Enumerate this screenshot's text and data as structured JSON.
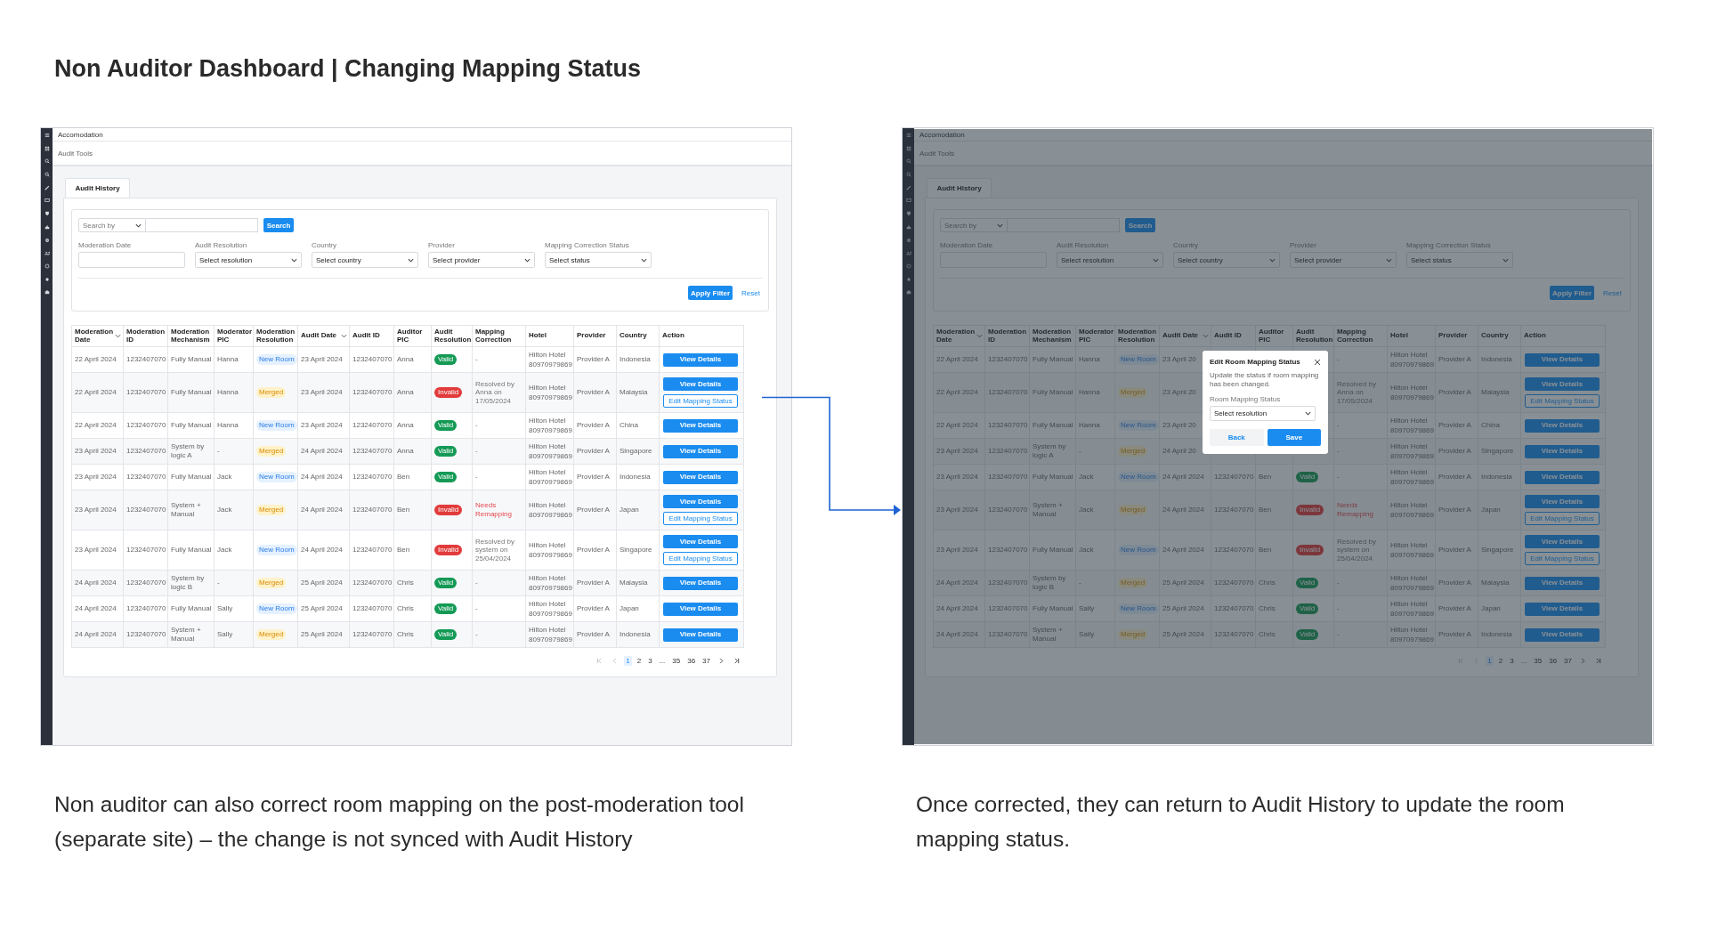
{
  "title": "Non Auditor Dashboard | Changing Mapping Status",
  "screens": [
    {
      "breadcrumb": "Accomodation",
      "section": "Audit Tools",
      "tabs": [
        {
          "label": "Audit History",
          "selected": true
        }
      ],
      "search": {
        "by": "Search by",
        "button": "Search"
      },
      "filters": [
        {
          "label": "Moderation Date",
          "kind": "date"
        },
        {
          "label": "Audit Resolution",
          "kind": "select",
          "value": "Select resolution"
        },
        {
          "label": "Country",
          "kind": "select",
          "value": "Select country"
        },
        {
          "label": "Provider",
          "kind": "select",
          "value": "Select provider"
        },
        {
          "label": "Mapping Correction Status",
          "kind": "select",
          "value": "Select status"
        }
      ],
      "apply_button": "Apply Filter",
      "reset_link": "Reset",
      "columns": [
        {
          "label": "Moderation Date",
          "sortable": true
        },
        {
          "label": "Moderation ID",
          "sortable": false
        },
        {
          "label": "Moderation Mechanism",
          "sortable": false
        },
        {
          "label": "Moderator PIC",
          "sortable": false
        },
        {
          "label": "Moderation Resolution",
          "sortable": false
        },
        {
          "label": "Audit Date",
          "sortable": true
        },
        {
          "label": "Audit ID",
          "sortable": false
        },
        {
          "label": "Auditor PIC",
          "sortable": false
        },
        {
          "label": "Audit Resolution",
          "sortable": false
        },
        {
          "label": "Mapping Correction",
          "sortable": false
        },
        {
          "label": "Hotel",
          "sortable": false
        },
        {
          "label": "Provider",
          "sortable": false
        },
        {
          "label": "Country",
          "sortable": false
        },
        {
          "label": "Action",
          "sortable": false
        }
      ],
      "rows": [
        {
          "moderation_date": "22 April 2024",
          "moderation_id": "1232407070",
          "mechanism": "Fully Manual",
          "moderator": "Hanna",
          "moderation_resolution": {
            "text": "New Room",
            "kind": "new_room"
          },
          "audit_date": "23 April 2024",
          "audit_id": "1232407070",
          "auditor": "Anna",
          "audit_resolution": {
            "text": "Valid",
            "kind": "valid"
          },
          "mapping_correction": {
            "text": "-",
            "kind": "plain"
          },
          "hotel": "Hilton Hotel",
          "hotel_code": "80970979869",
          "provider": "Provider A",
          "country": "Indonesia",
          "actions": [
            {
              "label": "View Details",
              "kind": "primary"
            }
          ]
        },
        {
          "moderation_date": "22 April 2024",
          "moderation_id": "1232407070",
          "mechanism": "Fully Manual",
          "moderator": "Hanna",
          "moderation_resolution": {
            "text": "Merged",
            "kind": "merged"
          },
          "audit_date": "23 April 2024",
          "audit_id": "1232407070",
          "auditor": "Anna",
          "audit_resolution": {
            "text": "Invalid",
            "kind": "invalid"
          },
          "mapping_correction": {
            "text": "Resolved by Anna on 17/05/2024",
            "kind": "plain"
          },
          "hotel": "Hilton Hotel",
          "hotel_code": "80970979869",
          "provider": "Provider A",
          "country": "Malaysia",
          "actions": [
            {
              "label": "View Details",
              "kind": "primary"
            },
            {
              "label": "Edit Mapping Status",
              "kind": "outline"
            }
          ]
        },
        {
          "moderation_date": "22 April 2024",
          "moderation_id": "1232407070",
          "mechanism": "Fully Manual",
          "moderator": "Hanna",
          "moderation_resolution": {
            "text": "New Room",
            "kind": "new_room"
          },
          "audit_date": "23 April 2024",
          "audit_id": "1232407070",
          "auditor": "Anna",
          "audit_resolution": {
            "text": "Valid",
            "kind": "valid"
          },
          "mapping_correction": {
            "text": "-",
            "kind": "plain"
          },
          "hotel": "Hilton Hotel",
          "hotel_code": "80970979869",
          "provider": "Provider A",
          "country": "China",
          "actions": [
            {
              "label": "View Details",
              "kind": "primary"
            }
          ]
        },
        {
          "moderation_date": "23 April 2024",
          "moderation_id": "1232407070",
          "mechanism": "System by logic A",
          "moderator": "-",
          "moderation_resolution": {
            "text": "Merged",
            "kind": "merged"
          },
          "audit_date": "24 April 2024",
          "audit_id": "1232407070",
          "auditor": "Anna",
          "audit_resolution": {
            "text": "Valid",
            "kind": "valid"
          },
          "mapping_correction": {
            "text": "-",
            "kind": "plain"
          },
          "hotel": "Hilton Hotel",
          "hotel_code": "80970979869",
          "provider": "Provider A",
          "country": "Singapore",
          "actions": [
            {
              "label": "View Details",
              "kind": "primary"
            }
          ]
        },
        {
          "moderation_date": "23 April 2024",
          "moderation_id": "1232407070",
          "mechanism": "Fully Manual",
          "moderator": "Jack",
          "moderation_resolution": {
            "text": "New Room",
            "kind": "new_room"
          },
          "audit_date": "24 April 2024",
          "audit_id": "1232407070",
          "auditor": "Ben",
          "audit_resolution": {
            "text": "Valid",
            "kind": "valid"
          },
          "mapping_correction": {
            "text": "-",
            "kind": "plain"
          },
          "hotel": "Hilton Hotel",
          "hotel_code": "80970979869",
          "provider": "Provider A",
          "country": "Indonesia",
          "actions": [
            {
              "label": "View Details",
              "kind": "primary"
            }
          ]
        },
        {
          "moderation_date": "23 April 2024",
          "moderation_id": "1232407070",
          "mechanism": "System + Manual",
          "moderator": "Jack",
          "moderation_resolution": {
            "text": "Merged",
            "kind": "merged"
          },
          "audit_date": "24 April 2024",
          "audit_id": "1232407070",
          "auditor": "Ben",
          "audit_resolution": {
            "text": "Invalid",
            "kind": "invalid"
          },
          "mapping_correction": {
            "text": "Needs Remapping",
            "kind": "alert"
          },
          "hotel": "Hilton Hotel",
          "hotel_code": "80970979869",
          "provider": "Provider A",
          "country": "Japan",
          "actions": [
            {
              "label": "View Details",
              "kind": "primary"
            },
            {
              "label": "Edit Mapping Status",
              "kind": "outline"
            }
          ]
        },
        {
          "moderation_date": "23 April 2024",
          "moderation_id": "1232407070",
          "mechanism": "Fully Manual",
          "moderator": "Jack",
          "moderation_resolution": {
            "text": "New Room",
            "kind": "new_room"
          },
          "audit_date": "24 April 2024",
          "audit_id": "1232407070",
          "auditor": "Ben",
          "audit_resolution": {
            "text": "Invalid",
            "kind": "invalid"
          },
          "mapping_correction": {
            "text": "Resolved by system on 25/04/2024",
            "kind": "plain"
          },
          "hotel": "Hilton Hotel",
          "hotel_code": "80970979869",
          "provider": "Provider A",
          "country": "Singapore",
          "actions": [
            {
              "label": "View Details",
              "kind": "primary"
            },
            {
              "label": "Edit Mapping Status",
              "kind": "outline"
            }
          ]
        },
        {
          "moderation_date": "24 April 2024",
          "moderation_id": "1232407070",
          "mechanism": "System by logic B",
          "moderator": "-",
          "moderation_resolution": {
            "text": "Merged",
            "kind": "merged"
          },
          "audit_date": "25 April 2024",
          "audit_id": "1232407070",
          "auditor": "Chris",
          "audit_resolution": {
            "text": "Valid",
            "kind": "valid"
          },
          "mapping_correction": {
            "text": "-",
            "kind": "plain"
          },
          "hotel": "Hilton Hotel",
          "hotel_code": "80970979869",
          "provider": "Provider A",
          "country": "Malaysia",
          "actions": [
            {
              "label": "View Details",
              "kind": "primary"
            }
          ]
        },
        {
          "moderation_date": "24 April 2024",
          "moderation_id": "1232407070",
          "mechanism": "Fully Manual",
          "moderator": "Sally",
          "moderation_resolution": {
            "text": "New Room",
            "kind": "new_room"
          },
          "audit_date": "25 April 2024",
          "audit_id": "1232407070",
          "auditor": "Chris",
          "audit_resolution": {
            "text": "Valid",
            "kind": "valid"
          },
          "mapping_correction": {
            "text": "-",
            "kind": "plain"
          },
          "hotel": "Hilton Hotel",
          "hotel_code": "80970979869",
          "provider": "Provider A",
          "country": "Japan",
          "actions": [
            {
              "label": "View Details",
              "kind": "primary"
            }
          ]
        },
        {
          "moderation_date": "24 April 2024",
          "moderation_id": "1232407070",
          "mechanism": "System + Manual",
          "moderator": "Sally",
          "moderation_resolution": {
            "text": "Merged",
            "kind": "merged"
          },
          "audit_date": "25 April 2024",
          "audit_id": "1232407070",
          "auditor": "Chris",
          "audit_resolution": {
            "text": "Valid",
            "kind": "valid"
          },
          "mapping_correction": {
            "text": "-",
            "kind": "plain"
          },
          "hotel": "Hilton Hotel",
          "hotel_code": "80970979869",
          "provider": "Provider A",
          "country": "Indonesia",
          "actions": [
            {
              "label": "View Details",
              "kind": "primary"
            }
          ]
        }
      ],
      "pagination": [
        {
          "label": "1",
          "selected": true
        },
        {
          "label": "2",
          "selected": false
        },
        {
          "label": "3",
          "selected": false
        },
        {
          "label": "...",
          "selected": false
        },
        {
          "label": "35",
          "selected": false
        },
        {
          "label": "36",
          "selected": false
        },
        {
          "label": "37",
          "selected": false
        }
      ],
      "caption": "Non auditor can also correct room mapping on the post-moderation tool (separate site) – the change is not synced with Audit History"
    },
    {
      "breadcrumb": "Accomodation",
      "section": "Audit Tools",
      "tabs": [
        {
          "label": "Audit History",
          "selected": true
        }
      ],
      "search": {
        "by": "Search by",
        "button": "Search"
      },
      "filters": [
        {
          "label": "Moderation Date",
          "kind": "date"
        },
        {
          "label": "Audit Resolution",
          "kind": "select",
          "value": "Select resolution"
        },
        {
          "label": "Country",
          "kind": "select",
          "value": "Select country"
        },
        {
          "label": "Provider",
          "kind": "select",
          "value": "Select provider"
        },
        {
          "label": "Mapping Correction Status",
          "kind": "select",
          "value": "Select status"
        }
      ],
      "apply_button": "Apply Filter",
      "reset_link": "Reset",
      "columns": [
        {
          "label": "Moderation Date",
          "sortable": true
        },
        {
          "label": "Moderation ID",
          "sortable": false
        },
        {
          "label": "Moderation Mechanism",
          "sortable": false
        },
        {
          "label": "Moderator PIC",
          "sortable": false
        },
        {
          "label": "Moderation Resolution",
          "sortable": false
        },
        {
          "label": "Audit Date",
          "sortable": true
        },
        {
          "label": "Audit ID",
          "sortable": false
        },
        {
          "label": "Auditor PIC",
          "sortable": false
        },
        {
          "label": "Audit Resolution",
          "sortable": false
        },
        {
          "label": "Mapping Correction",
          "sortable": false
        },
        {
          "label": "Hotel",
          "sortable": false
        },
        {
          "label": "Provider",
          "sortable": false
        },
        {
          "label": "Country",
          "sortable": false
        },
        {
          "label": "Action",
          "sortable": false
        }
      ],
      "rows": [
        {
          "moderation_date": "22 April 2024",
          "moderation_id": "1232407070",
          "mechanism": "Fully Manual",
          "moderator": "Hanna",
          "moderation_resolution": {
            "text": "New Room",
            "kind": "new_room"
          },
          "audit_date": "23 April 20",
          "mapping_correction": {
            "text": "-",
            "kind": "plain"
          },
          "hotel": "Hilton Hotel",
          "hotel_code": "80970979869",
          "provider": "Provider A",
          "country": "Indonesia",
          "actions": [
            {
              "label": "View Details",
              "kind": "primary"
            }
          ]
        },
        {
          "moderation_date": "22 April 2024",
          "moderation_id": "1232407070",
          "mechanism": "Fully Manual",
          "moderator": "Hanna",
          "moderation_resolution": {
            "text": "Merged",
            "kind": "merged"
          },
          "audit_date": "23 April 20",
          "mapping_correction": {
            "text": "Resolved by Anna on 17/05/2024",
            "kind": "plain"
          },
          "hotel": "Hilton Hotel",
          "hotel_code": "80970979869",
          "provider": "Provider A",
          "country": "Malaysia",
          "actions": [
            {
              "label": "View Details",
              "kind": "primary"
            },
            {
              "label": "Edit Mapping Status",
              "kind": "outline"
            }
          ]
        },
        {
          "moderation_date": "22 April 2024",
          "moderation_id": "1232407070",
          "mechanism": "Fully Manual",
          "moderator": "Hanna",
          "moderation_resolution": {
            "text": "New Room",
            "kind": "new_room"
          },
          "audit_date": "23 April 20",
          "mapping_correction": {
            "text": "-",
            "kind": "plain"
          },
          "hotel": "Hilton Hotel",
          "hotel_code": "80970979869",
          "provider": "Provider A",
          "country": "China",
          "actions": [
            {
              "label": "View Details",
              "kind": "primary"
            }
          ]
        },
        {
          "moderation_date": "23 April 2024",
          "moderation_id": "1232407070",
          "mechanism": "System by logic A",
          "moderator": "-",
          "moderation_resolution": {
            "text": "Merged",
            "kind": "merged"
          },
          "audit_date": "24 April 20",
          "mapping_correction": {
            "text": "-",
            "kind": "plain"
          },
          "hotel": "Hilton Hotel",
          "hotel_code": "80970979869",
          "provider": "Provider A",
          "country": "Singapore",
          "actions": [
            {
              "label": "View Details",
              "kind": "primary"
            }
          ]
        },
        {
          "moderation_date": "23 April 2024",
          "moderation_id": "1232407070",
          "mechanism": "Fully Manual",
          "moderator": "Jack",
          "moderation_resolution": {
            "text": "New Room",
            "kind": "new_room"
          },
          "audit_date": "24 April 2024",
          "audit_id": "1232407070",
          "auditor": "Ben",
          "audit_resolution": {
            "text": "Valid",
            "kind": "valid"
          },
          "mapping_correction": {
            "text": "-",
            "kind": "plain"
          },
          "hotel": "Hilton Hotel",
          "hotel_code": "80970979869",
          "provider": "Provider A",
          "country": "Indonesia",
          "actions": [
            {
              "label": "View Details",
              "kind": "primary"
            }
          ]
        },
        {
          "moderation_date": "23 April 2024",
          "moderation_id": "1232407070",
          "mechanism": "System + Manual",
          "moderator": "Jack",
          "moderation_resolution": {
            "text": "Merged",
            "kind": "merged"
          },
          "audit_date": "24 April 2024",
          "audit_id": "1232407070",
          "auditor": "Ben",
          "audit_resolution": {
            "text": "Invalid",
            "kind": "invalid"
          },
          "mapping_correction": {
            "text": "Needs Remapping",
            "kind": "alert"
          },
          "hotel": "Hilton Hotel",
          "hotel_code": "80970979869",
          "provider": "Provider A",
          "country": "Japan",
          "actions": [
            {
              "label": "View Details",
              "kind": "primary"
            },
            {
              "label": "Edit Mapping Status",
              "kind": "outline"
            }
          ]
        },
        {
          "moderation_date": "23 April 2024",
          "moderation_id": "1232407070",
          "mechanism": "Fully Manual",
          "moderator": "Jack",
          "moderation_resolution": {
            "text": "New Room",
            "kind": "new_room"
          },
          "audit_date": "24 April 2024",
          "audit_id": "1232407070",
          "auditor": "Ben",
          "audit_resolution": {
            "text": "Invalid",
            "kind": "invalid"
          },
          "mapping_correction": {
            "text": "Resolved by system on 25/04/2024",
            "kind": "plain"
          },
          "hotel": "Hilton Hotel",
          "hotel_code": "80970979869",
          "provider": "Provider A",
          "country": "Singapore",
          "actions": [
            {
              "label": "View Details",
              "kind": "primary"
            },
            {
              "label": "Edit Mapping Status",
              "kind": "outline"
            }
          ]
        },
        {
          "moderation_date": "24 April 2024",
          "moderation_id": "1232407070",
          "mechanism": "System by logic B",
          "moderator": "-",
          "moderation_resolution": {
            "text": "Merged",
            "kind": "merged"
          },
          "audit_date": "25 April 2024",
          "audit_id": "1232407070",
          "auditor": "Chris",
          "audit_resolution": {
            "text": "Valid",
            "kind": "valid"
          },
          "mapping_correction": {
            "text": "-",
            "kind": "plain"
          },
          "hotel": "Hilton Hotel",
          "hotel_code": "80970979869",
          "provider": "Provider A",
          "country": "Malaysia",
          "actions": [
            {
              "label": "View Details",
              "kind": "primary"
            }
          ]
        },
        {
          "moderation_date": "24 April 2024",
          "moderation_id": "1232407070",
          "mechanism": "Fully Manual",
          "moderator": "Sally",
          "moderation_resolution": {
            "text": "New Room",
            "kind": "new_room"
          },
          "audit_date": "25 April 2024",
          "audit_id": "1232407070",
          "auditor": "Chris",
          "audit_resolution": {
            "text": "Valid",
            "kind": "valid"
          },
          "mapping_correction": {
            "text": "-",
            "kind": "plain"
          },
          "hotel": "Hilton Hotel",
          "hotel_code": "80970979869",
          "provider": "Provider A",
          "country": "Japan",
          "actions": [
            {
              "label": "View Details",
              "kind": "primary"
            }
          ]
        },
        {
          "moderation_date": "24 April 2024",
          "moderation_id": "1232407070",
          "mechanism": "System + Manual",
          "moderator": "Sally",
          "moderation_resolution": {
            "text": "Merged",
            "kind": "merged"
          },
          "audit_date": "25 April 2024",
          "audit_id": "1232407070",
          "auditor": "Chris",
          "audit_resolution": {
            "text": "Valid",
            "kind": "valid"
          },
          "mapping_correction": {
            "text": "-",
            "kind": "plain"
          },
          "hotel": "Hilton Hotel",
          "hotel_code": "80970979869",
          "provider": "Provider A",
          "country": "Indonesia",
          "actions": [
            {
              "label": "View Details",
              "kind": "primary"
            }
          ]
        }
      ],
      "pagination": [
        {
          "label": "1",
          "selected": true
        },
        {
          "label": "2",
          "selected": false
        },
        {
          "label": "3",
          "selected": false
        },
        {
          "label": "...",
          "selected": false
        },
        {
          "label": "35",
          "selected": false
        },
        {
          "label": "36",
          "selected": false
        },
        {
          "label": "37",
          "selected": false
        }
      ],
      "modal": {
        "title": "Edit Room Mapping Status",
        "description": "Update the status if room mapping has been changed.",
        "field_label": "Room Mapping Status",
        "field_value": "Select resolution",
        "buttons": [
          {
            "label": "Back",
            "kind": "secondary"
          },
          {
            "label": "Save",
            "kind": "primary"
          }
        ]
      },
      "caption": "Once corrected, they can return to Audit History to update the room mapping status."
    }
  ]
}
